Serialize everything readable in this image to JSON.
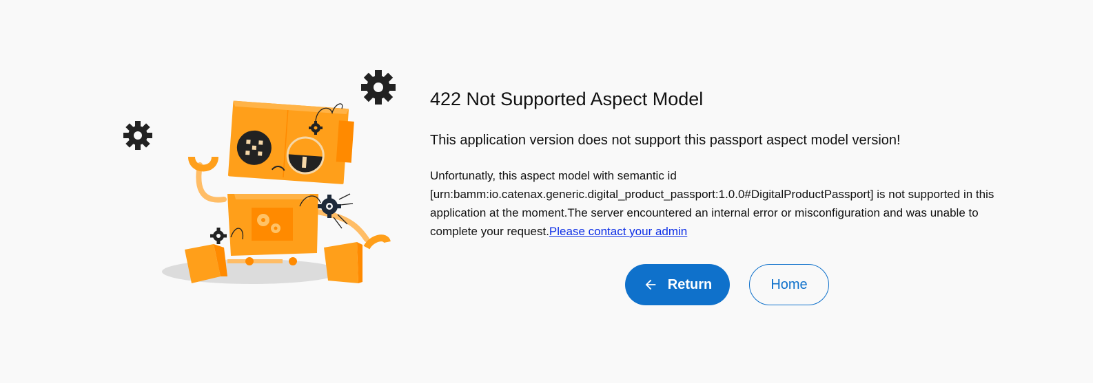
{
  "error": {
    "title": "422 Not Supported Aspect Model",
    "subtitle": "This application version does not support this passport aspect model version!",
    "description": "Unfortunatly, this aspect model with semantic id [urn:bamm:io.catenax.generic.digital_product_passport:1.0.0#DigitalProductPassport] is not supported in this application at the moment.The server encountered an internal error or misconfiguration and was unable to complete your request.",
    "contact_link": "Please contact your admin"
  },
  "actions": {
    "return_label": "Return",
    "home_label": "Home"
  },
  "colors": {
    "primary": "#0f71cb",
    "robot_orange": "#ff9f1a",
    "link": "#0b2de6"
  },
  "icons": {
    "return": "arrow-left-icon",
    "illustration": "broken-robot-illustration"
  }
}
